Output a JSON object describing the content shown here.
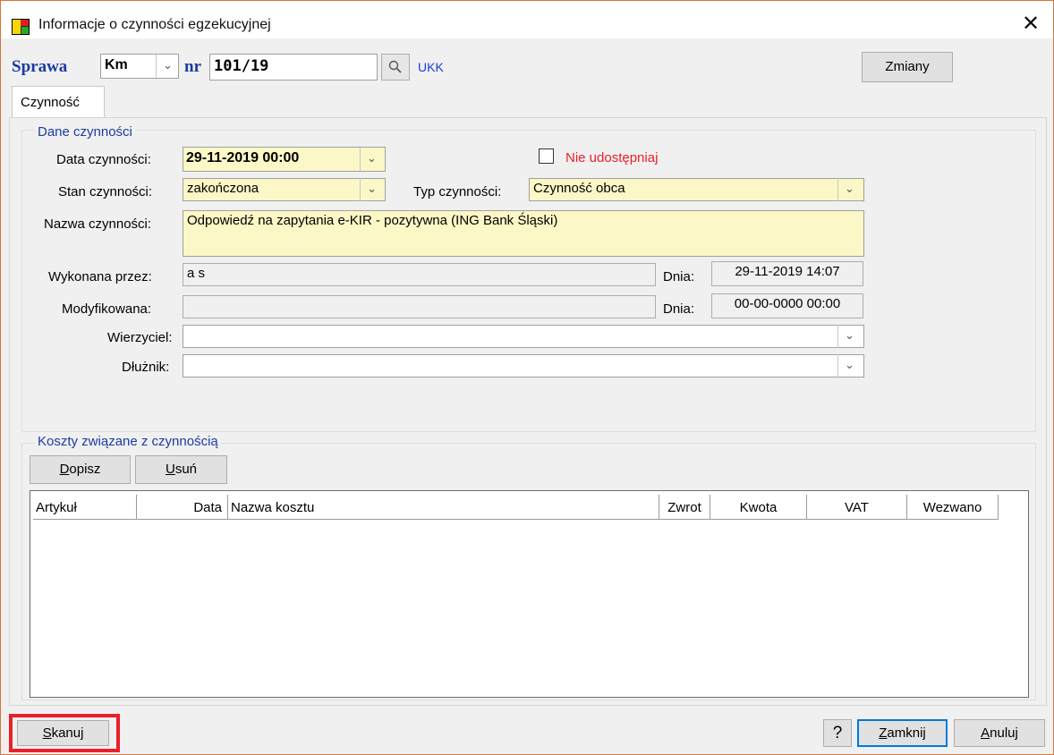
{
  "window": {
    "title": "Informacje o czynności egzekucyjnej",
    "close_symbol": "✕"
  },
  "case": {
    "label": "Sprawa",
    "type_value": "Km",
    "nr_label": "nr",
    "nr_value": "101/19",
    "ukk_link": "UKK",
    "changes_button": "Zmiany"
  },
  "tabs": [
    {
      "label": "Czynność"
    }
  ],
  "dane": {
    "group_title": "Dane czynności",
    "data_label": "Data czynności:",
    "data_value": "29-11-2019  00:00",
    "nie_udostepniaj": "Nie udostępniaj",
    "stan_label": "Stan czynności:",
    "stan_value": "zakończona",
    "typ_label": "Typ czynności:",
    "typ_value": "Czynność obca",
    "nazwa_label": "Nazwa czynności:",
    "nazwa_value": "Odpowiedź na zapytania e-KIR - pozytywna (ING Bank Śląski)",
    "wykonana_label": "Wykonana przez:",
    "wykonana_value": "a s",
    "dnia_label": "Dnia:",
    "dnia1_value": "29-11-2019 14:07",
    "modyfikowana_label": "Modyfikowana:",
    "modyfikowana_value": "",
    "dnia2_value": "00-00-0000 00:00",
    "wierzyciel_label": "Wierzyciel:",
    "wierzyciel_value": "",
    "dluznik_label": "Dłużnik:",
    "dluznik_value": ""
  },
  "koszty": {
    "group_title": "Koszty związane z czynnością",
    "dopisz_first": "D",
    "dopisz_rest": "opisz",
    "usun_first": "U",
    "usun_rest": "suń",
    "columns": [
      "Artykuł",
      "Data",
      "Nazwa kosztu",
      "Zwrot",
      "Kwota",
      "VAT",
      "Wezwano"
    ]
  },
  "footer": {
    "skanuj_first": "S",
    "skanuj_rest": "kanuj",
    "help": "?",
    "zamknij_first": "Z",
    "zamknij_rest": "amknij",
    "anuluj_first": "A",
    "anuluj_rest": "nuluj"
  },
  "colors": {
    "highlight_border": "#e8202a",
    "required_field": "#fbf7c6",
    "label_blue": "#1a3ca3",
    "warning_red": "#e8202a"
  }
}
